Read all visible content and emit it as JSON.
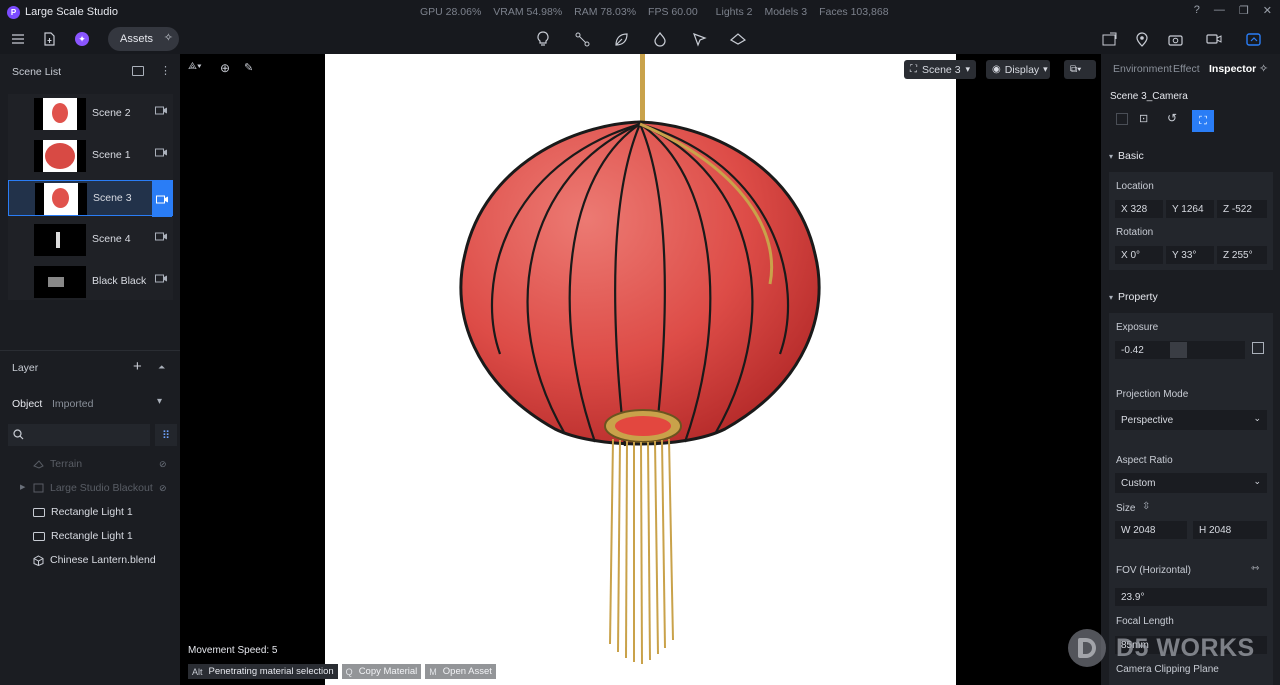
{
  "app": {
    "title": "Large Scale Studio",
    "logo_letter": "P"
  },
  "stats": {
    "gpu": "GPU 28.06%",
    "vram": "VRAM 54.98%",
    "ram": "RAM 78.03%",
    "fps": "FPS 60.00",
    "lights": "Lights 2",
    "models": "Models 3",
    "faces": "Faces 103,868"
  },
  "toolbar": {
    "assets_label": "Assets"
  },
  "scene_list": {
    "title": "Scene List",
    "items": [
      {
        "label": "Scene 2",
        "selected": false
      },
      {
        "label": "Scene 1",
        "selected": false
      },
      {
        "label": "Scene 3",
        "selected": true
      },
      {
        "label": "Scene 4",
        "selected": false
      },
      {
        "label": "Black Black",
        "selected": false
      }
    ]
  },
  "layer": {
    "title": "Layer",
    "tabs": [
      "Object",
      "Imported"
    ],
    "search_placeholder": "",
    "items": [
      {
        "label": "Terrain",
        "dimmed": true
      },
      {
        "label": "Large Studio Blackout",
        "dimmed": true
      },
      {
        "label": "Rectangle Light 1",
        "dimmed": false
      },
      {
        "label": "Rectangle Light 1",
        "dimmed": false
      },
      {
        "label": "Chinese Lantern.blend",
        "dimmed": false
      }
    ]
  },
  "viewport": {
    "scene_selector": "Scene 3",
    "display_label": "Display",
    "movement_speed": "Movement Speed: 5",
    "hints": [
      {
        "key": "Alt",
        "label": "Penetrating material selection"
      },
      {
        "key": "Q",
        "label": "Copy Material"
      },
      {
        "key": "M",
        "label": "Open Asset"
      }
    ]
  },
  "inspector": {
    "tabs": [
      "Environment",
      "Effect",
      "Inspector"
    ],
    "active_tab": "Inspector",
    "camera_name": "Scene 3_Camera",
    "basic": {
      "title": "Basic",
      "location_label": "Location",
      "location": {
        "x": "X  328",
        "y": "Y  1264",
        "z": "Z  -522"
      },
      "rotation_label": "Rotation",
      "rotation": {
        "x": "X  0°",
        "y": "Y  33°",
        "z": "Z  255°"
      }
    },
    "property": {
      "title": "Property",
      "exposure_label": "Exposure",
      "exposure_value": "-0.42",
      "projection_label": "Projection Mode",
      "projection_value": "Perspective",
      "aspect_label": "Aspect Ratio",
      "aspect_value": "Custom",
      "size_label": "Size",
      "size_w": "W  2048",
      "size_h": "H  2048",
      "fov_label": "FOV (Horizontal)",
      "fov_value": "23.9°",
      "focal_label": "Focal Length",
      "focal_value": "85mm",
      "clipping_label": "Camera Clipping Plane"
    }
  },
  "watermark": "D5 WORKS",
  "colors": {
    "accent": "#2a7df6",
    "lantern_red": "#e0524c",
    "gold": "#c9a24a"
  }
}
